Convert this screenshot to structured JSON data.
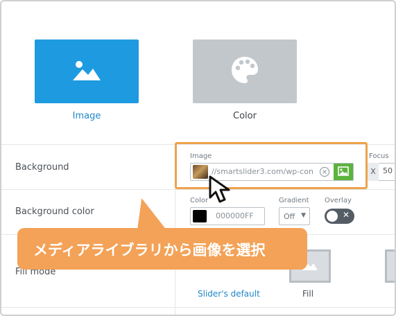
{
  "type_options": [
    {
      "label": "Image",
      "icon": "image-icon",
      "selected": true
    },
    {
      "label": "Color",
      "icon": "palette-icon",
      "selected": false
    }
  ],
  "rows": {
    "background": {
      "label": "Background",
      "image_label": "Image",
      "image_url": "//smartslider3.com/wp-con",
      "focus_label": "Focus",
      "focus_axis": "X",
      "focus_value": "50"
    },
    "background_color": {
      "label": "Background color",
      "color_label": "Color",
      "color_value": "000000FF",
      "gradient_label": "Gradient",
      "gradient_value": "Off",
      "overlay_label": "Overlay",
      "overlay_on": false
    },
    "fill_mode": {
      "label": "Fill mode",
      "options": [
        {
          "label": "Slider's default",
          "selected": true
        },
        {
          "label": "Fill",
          "selected": false
        }
      ]
    }
  },
  "callout": {
    "text": "メディアライブラリから画像を選択"
  },
  "colors": {
    "accent_blue": "#1e9be0",
    "highlight_orange": "#eea24a",
    "callout_orange": "#f3a257",
    "gallery_green": "#5cb33e"
  }
}
